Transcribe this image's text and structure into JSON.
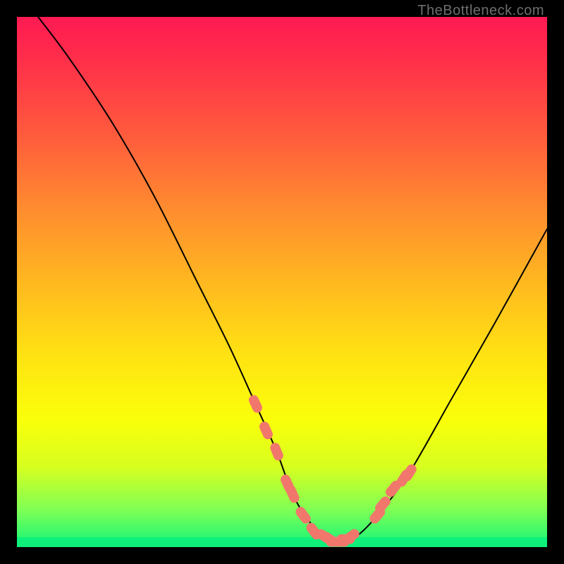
{
  "watermark": "TheBottleneck.com",
  "colors": {
    "frame_bg": "#000000",
    "gradient_stops": [
      "#ff1a52",
      "#ff2e4a",
      "#ff5a3d",
      "#ff8b2f",
      "#ffb820",
      "#ffe312",
      "#faff0a",
      "#d6ff20",
      "#7fff55",
      "#10f57a"
    ],
    "curve_stroke": "#000000",
    "marker_fill": "#f1776c"
  },
  "chart_data": {
    "type": "line",
    "title": "",
    "xlabel": "",
    "ylabel": "",
    "xlim": [
      0,
      100
    ],
    "ylim": [
      0,
      100
    ],
    "grid": false,
    "legend": false,
    "series": [
      {
        "name": "curve",
        "x": [
          4,
          10,
          18,
          26,
          34,
          40,
          45,
          49,
          52,
          55,
          58,
          61,
          64,
          68,
          74,
          82,
          90,
          100
        ],
        "y": [
          100,
          92,
          80,
          66,
          50,
          38,
          27,
          18,
          10,
          5,
          2,
          1,
          2,
          6,
          14,
          28,
          42,
          60
        ]
      }
    ],
    "markers": {
      "name": "highlighted-points",
      "x": [
        45,
        47,
        49,
        51,
        52,
        54,
        56,
        58,
        59,
        60,
        61,
        62,
        63,
        68,
        69,
        71,
        73,
        74
      ],
      "y": [
        27,
        22,
        18,
        12,
        10,
        6,
        3,
        2,
        1.5,
        1,
        1,
        1.5,
        2,
        6,
        8,
        11,
        13,
        14
      ]
    }
  }
}
